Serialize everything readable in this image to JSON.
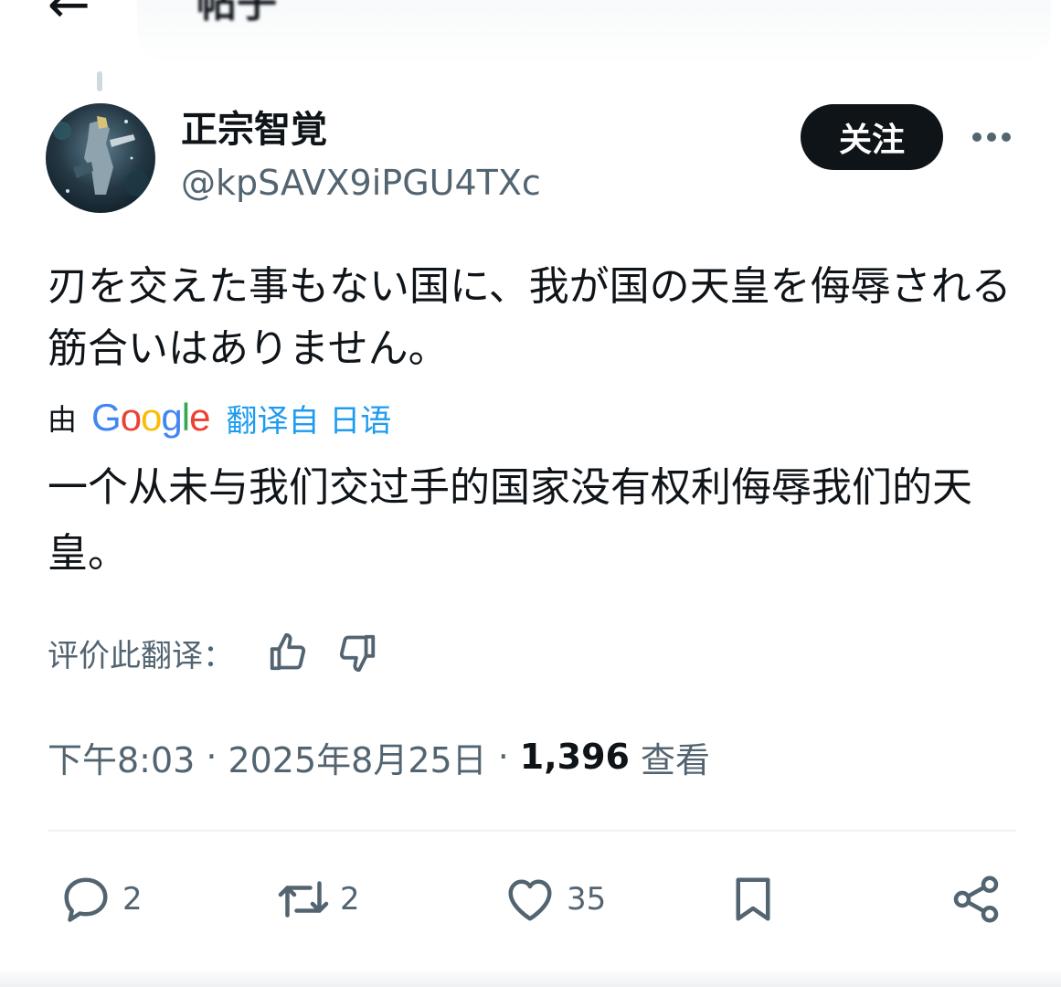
{
  "header": {
    "title": "帖子"
  },
  "post": {
    "author": {
      "display_name": "正宗智覚",
      "handle": "@kpSAVX9iPGU4TXc"
    },
    "follow_label": "关注",
    "text": "刃を交えた事もない国に、我が国の天皇を侮辱される筋合いはありません。",
    "translation": {
      "by_label": "由",
      "provider": "Google",
      "link_text": "翻译自 日语",
      "text": "一个从未与我们交过手的国家没有权利侮辱我们的天皇。"
    },
    "rate_label": "评价此翻译：",
    "meta": {
      "time": "下午8:03",
      "date": "2025年8月25日",
      "separator": "·",
      "views_count": "1,396",
      "views_label": "查看"
    },
    "actions": {
      "replies": "2",
      "reposts": "2",
      "likes": "35"
    }
  },
  "colors": {
    "text_primary": "#0f1419",
    "text_secondary": "#536471",
    "link_blue": "#1d9bf0",
    "button_dark": "#0f1419",
    "divider": "#eff3f4"
  },
  "icons": [
    "back-arrow-icon",
    "more-icon",
    "thumbs-up-icon",
    "thumbs-down-icon",
    "reply-icon",
    "repost-icon",
    "like-icon",
    "bookmark-icon",
    "share-icon"
  ]
}
